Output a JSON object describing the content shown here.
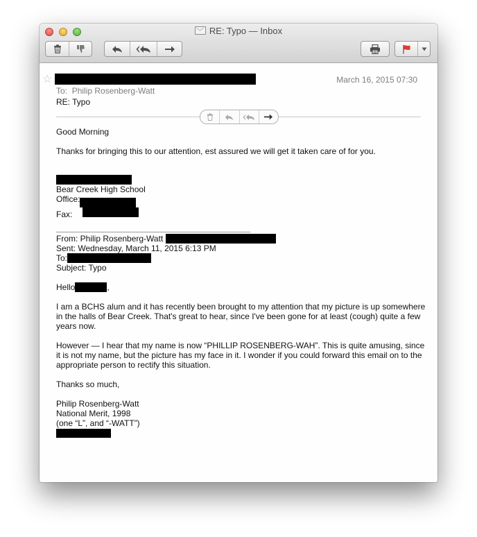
{
  "window": {
    "title": "RE: Typo — Inbox",
    "icon": "envelope-icon",
    "toolbar": {
      "delete_icon": "trash-icon",
      "junk_icon": "thumbs-down-icon",
      "reply_icon": "reply-arrow-icon",
      "reply_all_icon": "reply-all-arrow-icon",
      "forward_icon": "forward-arrow-icon",
      "print_icon": "printer-icon",
      "flag_icon": "flag-icon",
      "flag_color": "#e03a2d"
    }
  },
  "message": {
    "date": "March 16, 2015  07:30",
    "to_label": "To:",
    "to_name": "Philip Rosenberg-Watt",
    "subject": "RE: Typo",
    "body": {
      "greeting": "Good Morning",
      "line1": "Thanks for bringing this to our attention,  est assured we will get it taken care of for you.",
      "school": "Bear Creek High School",
      "office_label": "Office:",
      "fax_label": "Fax:"
    },
    "quoted": {
      "from": "From: Philip Rosenberg-Watt ",
      "sent": "Sent: Wednesday, March 11, 2015 6:13 PM",
      "to": "To:",
      "subject": "Subject: Typo",
      "hello": "Hello",
      "hello_comma": ",",
      "para1": "I am a BCHS alum and it has recently been brought to my attention that my picture is up somewhere in the halls of Bear Creek. That's great to hear, since I've been gone for at least (cough) quite a few years now.",
      "para2": "However — I hear that my name is now “PHILLIP ROSENBERG-WAH”. This is quite amusing, since it is not my name, but the picture has my face in it. I wonder if you could forward this email on to the appropriate person to rectify this situation.",
      "thanks": "Thanks so much,",
      "sig_name": "Philip Rosenberg-Watt",
      "sig_line2": "National Merit, 1998",
      "sig_line3": "(one “L”, and “-WATT”)"
    }
  }
}
